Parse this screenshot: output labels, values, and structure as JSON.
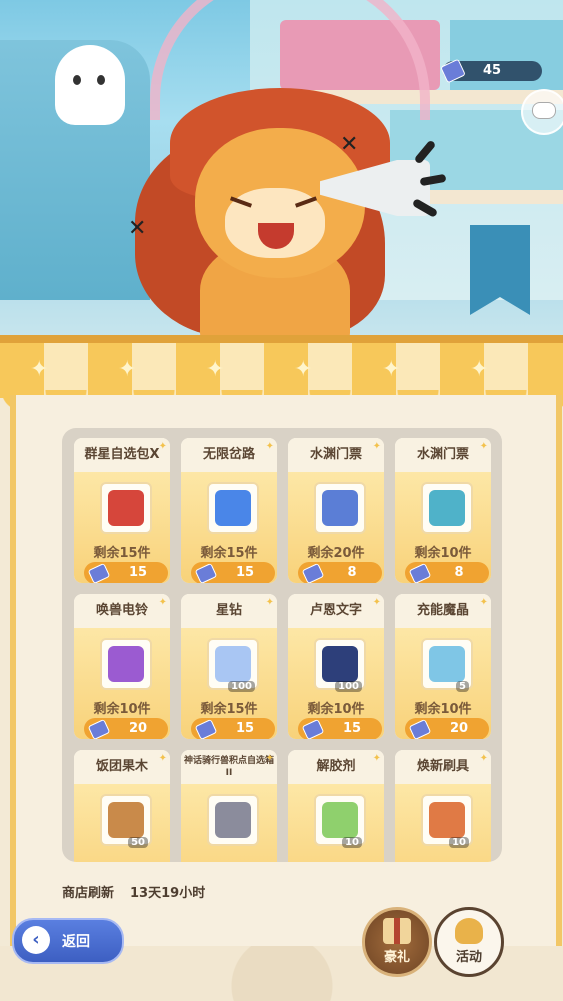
{
  "hud": {
    "currency_value": "45"
  },
  "shop": {
    "items": [
      {
        "name": "群星自选包X",
        "remaining": "剩余15件",
        "price": "15",
        "quantity": "",
        "icon": "card-pack-icon",
        "color": "#d6463b"
      },
      {
        "name": "无限岔路",
        "remaining": "剩余15件",
        "price": "15",
        "quantity": "",
        "icon": "blue-cube-icon",
        "color": "#4a86e8"
      },
      {
        "name": "水渊门票",
        "remaining": "剩余20件",
        "price": "8",
        "quantity": "",
        "icon": "ticket-icon",
        "color": "#5b7ed6"
      },
      {
        "name": "水渊门票",
        "remaining": "剩余10件",
        "price": "8",
        "quantity": "",
        "icon": "ticket-icon",
        "color": "#4fb2c9"
      },
      {
        "name": "唤兽电铃",
        "remaining": "剩余10件",
        "price": "20",
        "quantity": "",
        "icon": "bell-icon",
        "color": "#9b5bd1"
      },
      {
        "name": "星钻",
        "remaining": "剩余15件",
        "price": "15",
        "quantity": "100",
        "icon": "star-diamond-icon",
        "color": "#a9c6f3"
      },
      {
        "name": "卢恩文字",
        "remaining": "剩余10件",
        "price": "15",
        "quantity": "100",
        "icon": "rune-orb-icon",
        "color": "#2d3f7a"
      },
      {
        "name": "充能魔晶",
        "remaining": "剩余10件",
        "price": "20",
        "quantity": "5",
        "icon": "crystal-icon",
        "color": "#7fc6e6"
      },
      {
        "name": "饭团果木",
        "remaining": "",
        "price": "",
        "quantity": "50",
        "icon": "rice-roll-icon",
        "color": "#c98a4a"
      },
      {
        "name": "神话骑行兽积点自选箱 II",
        "remaining": "",
        "price": "",
        "quantity": "",
        "icon": "chest-icon",
        "color": "#8b8c9c"
      },
      {
        "name": "解胶剂",
        "remaining": "",
        "price": "",
        "quantity": "10",
        "icon": "potion-icon",
        "color": "#8fd06d"
      },
      {
        "name": "焕新刷具",
        "remaining": "",
        "price": "",
        "quantity": "10",
        "icon": "brush-icon",
        "color": "#e07a45"
      }
    ],
    "refresh_label": "商店刷新",
    "refresh_time": "13天19小时"
  },
  "nav": {
    "back_label": "返回",
    "gift_label": "豪礼",
    "activity_label": "活动"
  }
}
